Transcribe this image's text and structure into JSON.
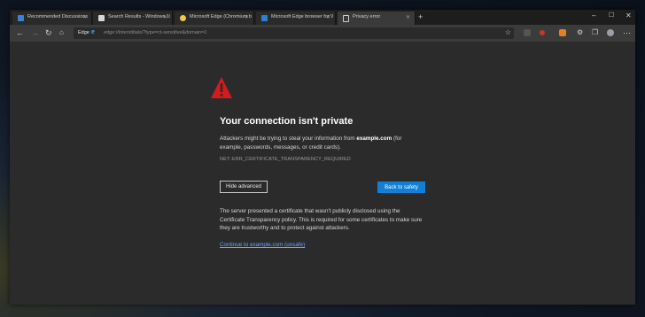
{
  "tabs": [
    {
      "title": "Recommended Discussions - Ed",
      "favicon_color": "#3b82d6"
    },
    {
      "title": "Search Results - Windows 10 Fo",
      "favicon_color": "#d7d7d7"
    },
    {
      "title": "Microsoft Edge (Chromium bas",
      "favicon_color": "#f2c94c"
    },
    {
      "title": "Microsoft Edge browser for Wi",
      "favicon_color": "#2d7fd3"
    },
    {
      "title": "Privacy error",
      "favicon_color": "#d0d0d0"
    }
  ],
  "addressbar": {
    "scheme_label": "Edge",
    "url": "edge://interstitials/?type=ct-sensitive&domain=1"
  },
  "error_page": {
    "heading": "Your connection isn't private",
    "desc_prefix": "Attackers might be trying to steal your information from ",
    "domain": "example.com",
    "desc_suffix": " (for example, passwords, messages, or credit cards).",
    "error_code": "NET::ERR_CERTIFICATE_TRANSPARENCY_REQUIRED",
    "hide_advanced_label": "Hide advanced",
    "back_to_safety_label": "Back to safety",
    "advanced_text": "The server presented a certificate that wasn't publicly disclosed using the Certificate Transparency policy. This is required for some certificates to make sure they are trustworthy and to protect against attackers.",
    "continue_link": "Continue to example.com (unsafe)"
  },
  "colors": {
    "warning_icon": "#d01c1c",
    "primary_button": "#0f7fd8",
    "link": "#6aa6ff"
  }
}
